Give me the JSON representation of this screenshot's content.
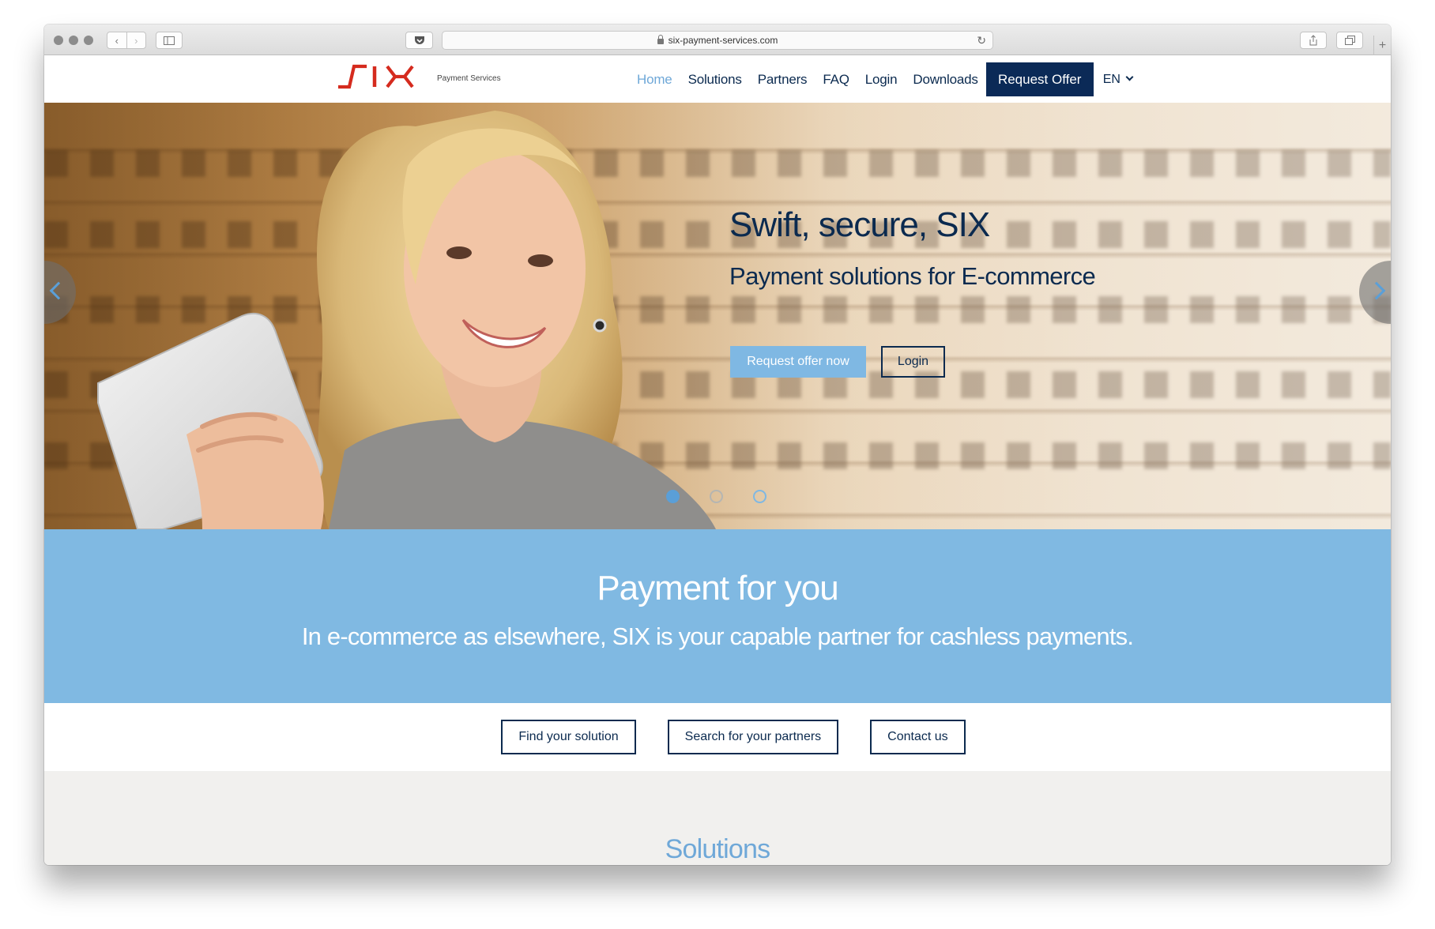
{
  "browser": {
    "url": "six-payment-services.com"
  },
  "header": {
    "logo_sub": "Payment Services",
    "nav": [
      {
        "label": "Home",
        "active": true
      },
      {
        "label": "Solutions"
      },
      {
        "label": "Partners"
      },
      {
        "label": "FAQ"
      },
      {
        "label": "Login"
      },
      {
        "label": "Downloads"
      }
    ],
    "cta": "Request Offer",
    "lang": "EN"
  },
  "hero": {
    "title": "Swift, secure, SIX",
    "subtitle": "Payment solutions for E-commerce",
    "primary_button": "Request offer now",
    "secondary_button": "Login"
  },
  "band": {
    "title": "Payment for you",
    "subtitle": "In e-commerce as elsewhere, SIX is your capable partner for cashless payments."
  },
  "actions": {
    "find": "Find your solution",
    "partners": "Search for your partners",
    "contact": "Contact us"
  },
  "solutions": {
    "title": "Solutions"
  },
  "colors": {
    "navy": "#0b2a4f",
    "accent_blue": "#80b9e2",
    "logo_red": "#d52b1e"
  }
}
